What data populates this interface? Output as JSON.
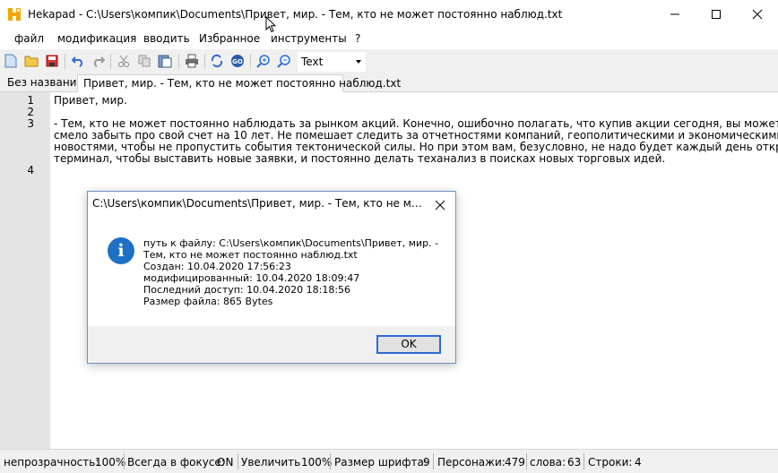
{
  "window": {
    "title": "Нekapad - C:\\Users\\компик\\Documents\\Привет, мир.  - Тем, кто не может постоянно наблюд.txt"
  },
  "menu": [
    "файл",
    "модификация",
    "вводить",
    "Избранное",
    "инструменты",
    "?"
  ],
  "toolbar": {
    "syntax_select": "Text",
    "icons": [
      "new-file-icon",
      "open-folder-icon",
      "save-icon",
      "undo-icon",
      "redo-icon",
      "cut-icon",
      "copy-icon",
      "paste-icon",
      "print-icon",
      "replace-icon",
      "goto-icon",
      "zoom-in-icon",
      "zoom-out-icon"
    ]
  },
  "tabs": [
    {
      "label": "Без названия",
      "active": false
    },
    {
      "label": "Привет, мир.  - Тем, кто не может постоянно наблюд.txt",
      "active": true
    }
  ],
  "editor": {
    "line_numbers": [
      "1",
      "2",
      "3",
      "4"
    ],
    "lines": [
      "Привет, мир.",
      "",
      "- Тем, кто не может постоянно наблюдать за рынком акций. Конечно, ошибочно полагать, что купив акции сегодня, вы можете",
      "смело забыть про свой счет на 10 лет. Не помешает следить за отчетностями компаний, геополитическими и экономическими",
      "новостями, чтобы не пропустить события тектонической силы. Но при этом вам, безусловно, не надо будет каждый день открывать",
      "терминал, чтобы выставить новые заявки, и постоянно делать теханализ в поисках новых торговых идей."
    ]
  },
  "dialog": {
    "title": "C:\\Users\\компик\\Documents\\Привет, мир.  - Тем, кто не может постоянно наблюд.txt",
    "icon": "info-icon",
    "lines": [
      "путь к файлу: C:\\Users\\компик\\Documents\\Привет, мир.  -",
      "Тем, кто не может постоянно наблюд.txt",
      "Создан: 10.04.2020 17:56:23",
      "модифицированный: 10.04.2020 18:09:47",
      "Последний доступ: 10.04.2020 18:18:56",
      "Размер файла: 865 Bytes"
    ],
    "ok_label": "OK"
  },
  "status": {
    "opacity_label": "непрозрачность:",
    "opacity_value": "100%",
    "ontop_label": "Всегда в фокусе:",
    "ontop_value": "ON",
    "zoom_label": "Увеличить",
    "zoom_value": "100%",
    "font_label": "Размер шрифта:",
    "font_value": "9",
    "chars_label": "Персонажи:",
    "chars_value": "479",
    "words_label": "слова:",
    "words_value": "63",
    "lines_label": "Строки:",
    "lines_value": "4"
  },
  "colors": {
    "accent": "#1f6fc5",
    "gutter": "#e4e4e4",
    "chrome": "#f0f0f0",
    "ok_border": "#2a6bd6"
  }
}
